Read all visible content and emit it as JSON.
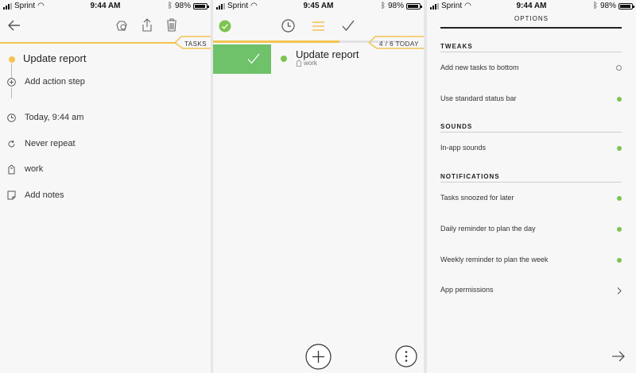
{
  "status_bars": [
    {
      "carrier": "Sprint",
      "time": "9:44 AM",
      "battery": "98%"
    },
    {
      "carrier": "Sprint",
      "time": "9:45 AM",
      "battery": "98%"
    },
    {
      "carrier": "Sprint",
      "time": "9:44 AM",
      "battery": "98%"
    }
  ],
  "detail": {
    "section_label": "TASKS",
    "task_title": "Update report",
    "add_step": "Add action step",
    "due": "Today, 9:44 am",
    "repeat": "Never repeat",
    "tag": "work",
    "notes": "Add notes"
  },
  "list": {
    "counter": "4 / 6 TODAY",
    "task_title": "Update report",
    "task_tag": "work",
    "progress_fraction": 0.67
  },
  "options": {
    "title": "OPTIONS",
    "sections": [
      {
        "heading": "TWEAKS",
        "items": [
          {
            "label": "Add new tasks to bottom",
            "on": false
          },
          {
            "label": "Use standard status bar",
            "on": true
          }
        ]
      },
      {
        "heading": "SOUNDS",
        "items": [
          {
            "label": "In-app sounds",
            "on": true
          }
        ]
      },
      {
        "heading": "NOTIFICATIONS",
        "items": [
          {
            "label": "Tasks snoozed for later",
            "on": true
          },
          {
            "label": "Daily reminder to plan the day",
            "on": true
          },
          {
            "label": "Weekly reminder to plan the week",
            "on": true
          }
        ]
      }
    ],
    "permissions": "App permissions"
  },
  "colors": {
    "accent": "#f3c34f",
    "done": "#7cc450"
  }
}
